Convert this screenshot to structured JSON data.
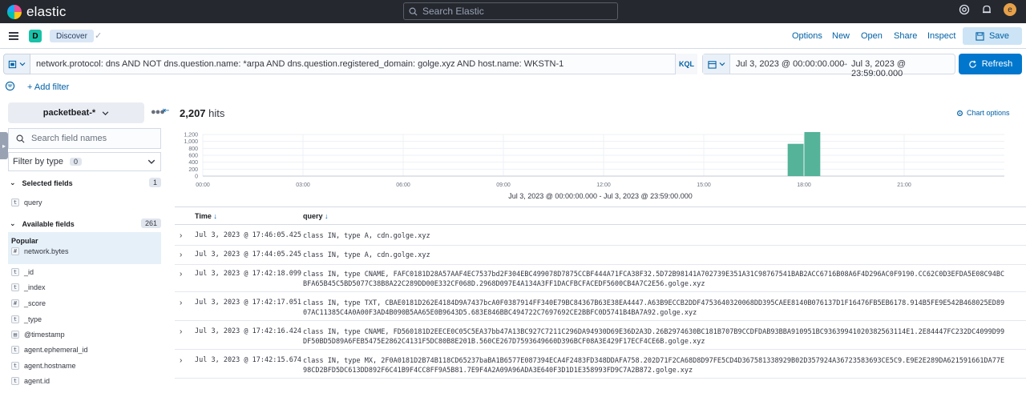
{
  "topbar": {
    "brand": "elastic",
    "search_placeholder": "Search Elastic",
    "avatar_letter": "e"
  },
  "navbar": {
    "space_letter": "D",
    "breadcrumb": "Discover",
    "links": [
      "Options",
      "New",
      "Open",
      "Share",
      "Inspect"
    ],
    "save_label": "Save"
  },
  "query": {
    "text": "network.protocol: dns AND NOT dns.question.name: *arpa AND dns.question.registered_domain: golge.xyz AND host.name: WKSTN-1",
    "language": "KQL",
    "date_start": "Jul 3, 2023 @ 00:00:00.000",
    "date_arrow": "→",
    "date_end": "Jul 3, 2023 @ 23:59:00.000",
    "refresh_label": "Refresh"
  },
  "filters": {
    "add_label": "+ Add filter"
  },
  "sidebar": {
    "index_pattern": "packetbeat-*",
    "search_placeholder": "Search field names",
    "filter_by_type": "Filter by type",
    "filter_count": "0",
    "selected_title": "Selected fields",
    "selected_count": "1",
    "selected_fields": [
      {
        "type": "t",
        "name": "query"
      }
    ],
    "available_title": "Available fields",
    "available_count": "261",
    "popular_title": "Popular",
    "popular_fields": [
      {
        "type": "#",
        "name": "network.bytes"
      }
    ],
    "fields": [
      {
        "type": "t",
        "name": "_id"
      },
      {
        "type": "t",
        "name": "_index"
      },
      {
        "type": "#",
        "name": "_score"
      },
      {
        "type": "t",
        "name": "_type"
      },
      {
        "type": "▤",
        "name": "@timestamp"
      },
      {
        "type": "t",
        "name": "agent.ephemeral_id"
      },
      {
        "type": "t",
        "name": "agent.hostname"
      },
      {
        "type": "t",
        "name": "agent.id"
      }
    ]
  },
  "main": {
    "hits_count": "2,207",
    "hits_label": "hits",
    "chart_options": "Chart options",
    "columns": {
      "time": "Time",
      "query": "query"
    },
    "rows": [
      {
        "time": "Jul 3, 2023 @ 17:46:05.425",
        "query": "class IN, type A, cdn.golge.xyz"
      },
      {
        "time": "Jul 3, 2023 @ 17:44:05.245",
        "query": "class IN, type A, cdn.golge.xyz"
      },
      {
        "time": "Jul 3, 2023 @ 17:42:18.099",
        "query": "class IN, type CNAME, FAFC0181D28A57AAF4EC7537bd2F304EBC499078D7875CCBF444A71FCA38F32.5D72B98141A702739E351A31C98767541BAB2ACC6716B08A6F4D296AC0F9190.CC62C0D3EFDA5E08C94BCBFA65B45C5BD5077C38B8A22C289DD00E332CF068D.2968D097E4A134A3FF1DACFBCFACEDF5600CB4A7C2E56.golge.xyz"
      },
      {
        "time": "Jul 3, 2023 @ 17:42:17.051",
        "query": "class IN, type TXT, CBAE0181D262E4184D9A7437bcA0F0387914FF340E79BC84367B63E38EA4447.A63B9ECCB2DDF4753640320068DD395CAEE8140B076137D1F16476FB5EB6178.914B5FE9E542B468025ED8907AC11385C4A0A00F3AD4B090B5AA65E0B9643D5.683E846BBC494722C7697692CE2BBFC0D5741B4BA7A92.golge.xyz"
      },
      {
        "time": "Jul 3, 2023 @ 17:42:16.424",
        "query": "class IN, type CNAME, FD560181D2EECE0C05C5EA37bb47A13BC927C7211C296DA94930D69E36D2A3D.26B2974630BC181B707B9CCDFDAB93BBA910951BC93639941020382563114E1.2E84447FC232DC4099D99DF50BD5D89A6FEB5475E2862C4131F5DC80B8E201B.560CE267D7593649660D396BCF08A3E429F17ECF4CE6B.golge.xyz"
      },
      {
        "time": "Jul 3, 2023 @ 17:42:15.674",
        "query": "class IN, type MX, 2F0A0181D2B74B118CD65237baBA1B6577E087394ECA4F2483FD348DDAFA758.202D71F2CA68D8D97FE5CD4D367581338929B02D357924A36723583693CE5C9.E9E2E289DA621591661DA77E98CD2BFD5DC613DD892F6C41B9F4CC8FF9A5B81.7E9F4A2A09A96ADA3E640F3D1D1E358993FD9C7A2B872.golge.xyz"
      }
    ]
  },
  "chart_data": {
    "type": "bar",
    "x_unit": "hour",
    "x_ticks": [
      "00:00",
      "03:00",
      "06:00",
      "09:00",
      "12:00",
      "15:00",
      "18:00",
      "21:00"
    ],
    "bars": [
      {
        "start_hour": 17.5,
        "end_hour": 18.0,
        "value": 930
      },
      {
        "start_hour": 18.0,
        "end_hour": 18.5,
        "value": 1270
      }
    ],
    "y_ticks": [
      "0",
      "200",
      "400",
      "600",
      "800",
      "1,000",
      "1,200"
    ],
    "ylim": [
      0,
      1200
    ],
    "xlim": [
      0,
      24
    ],
    "range_label": "Jul 3, 2023 @ 00:00:00.000 - Jul 3, 2023 @ 23:59:00.000",
    "bar_color": "#54b399",
    "grid": true
  }
}
